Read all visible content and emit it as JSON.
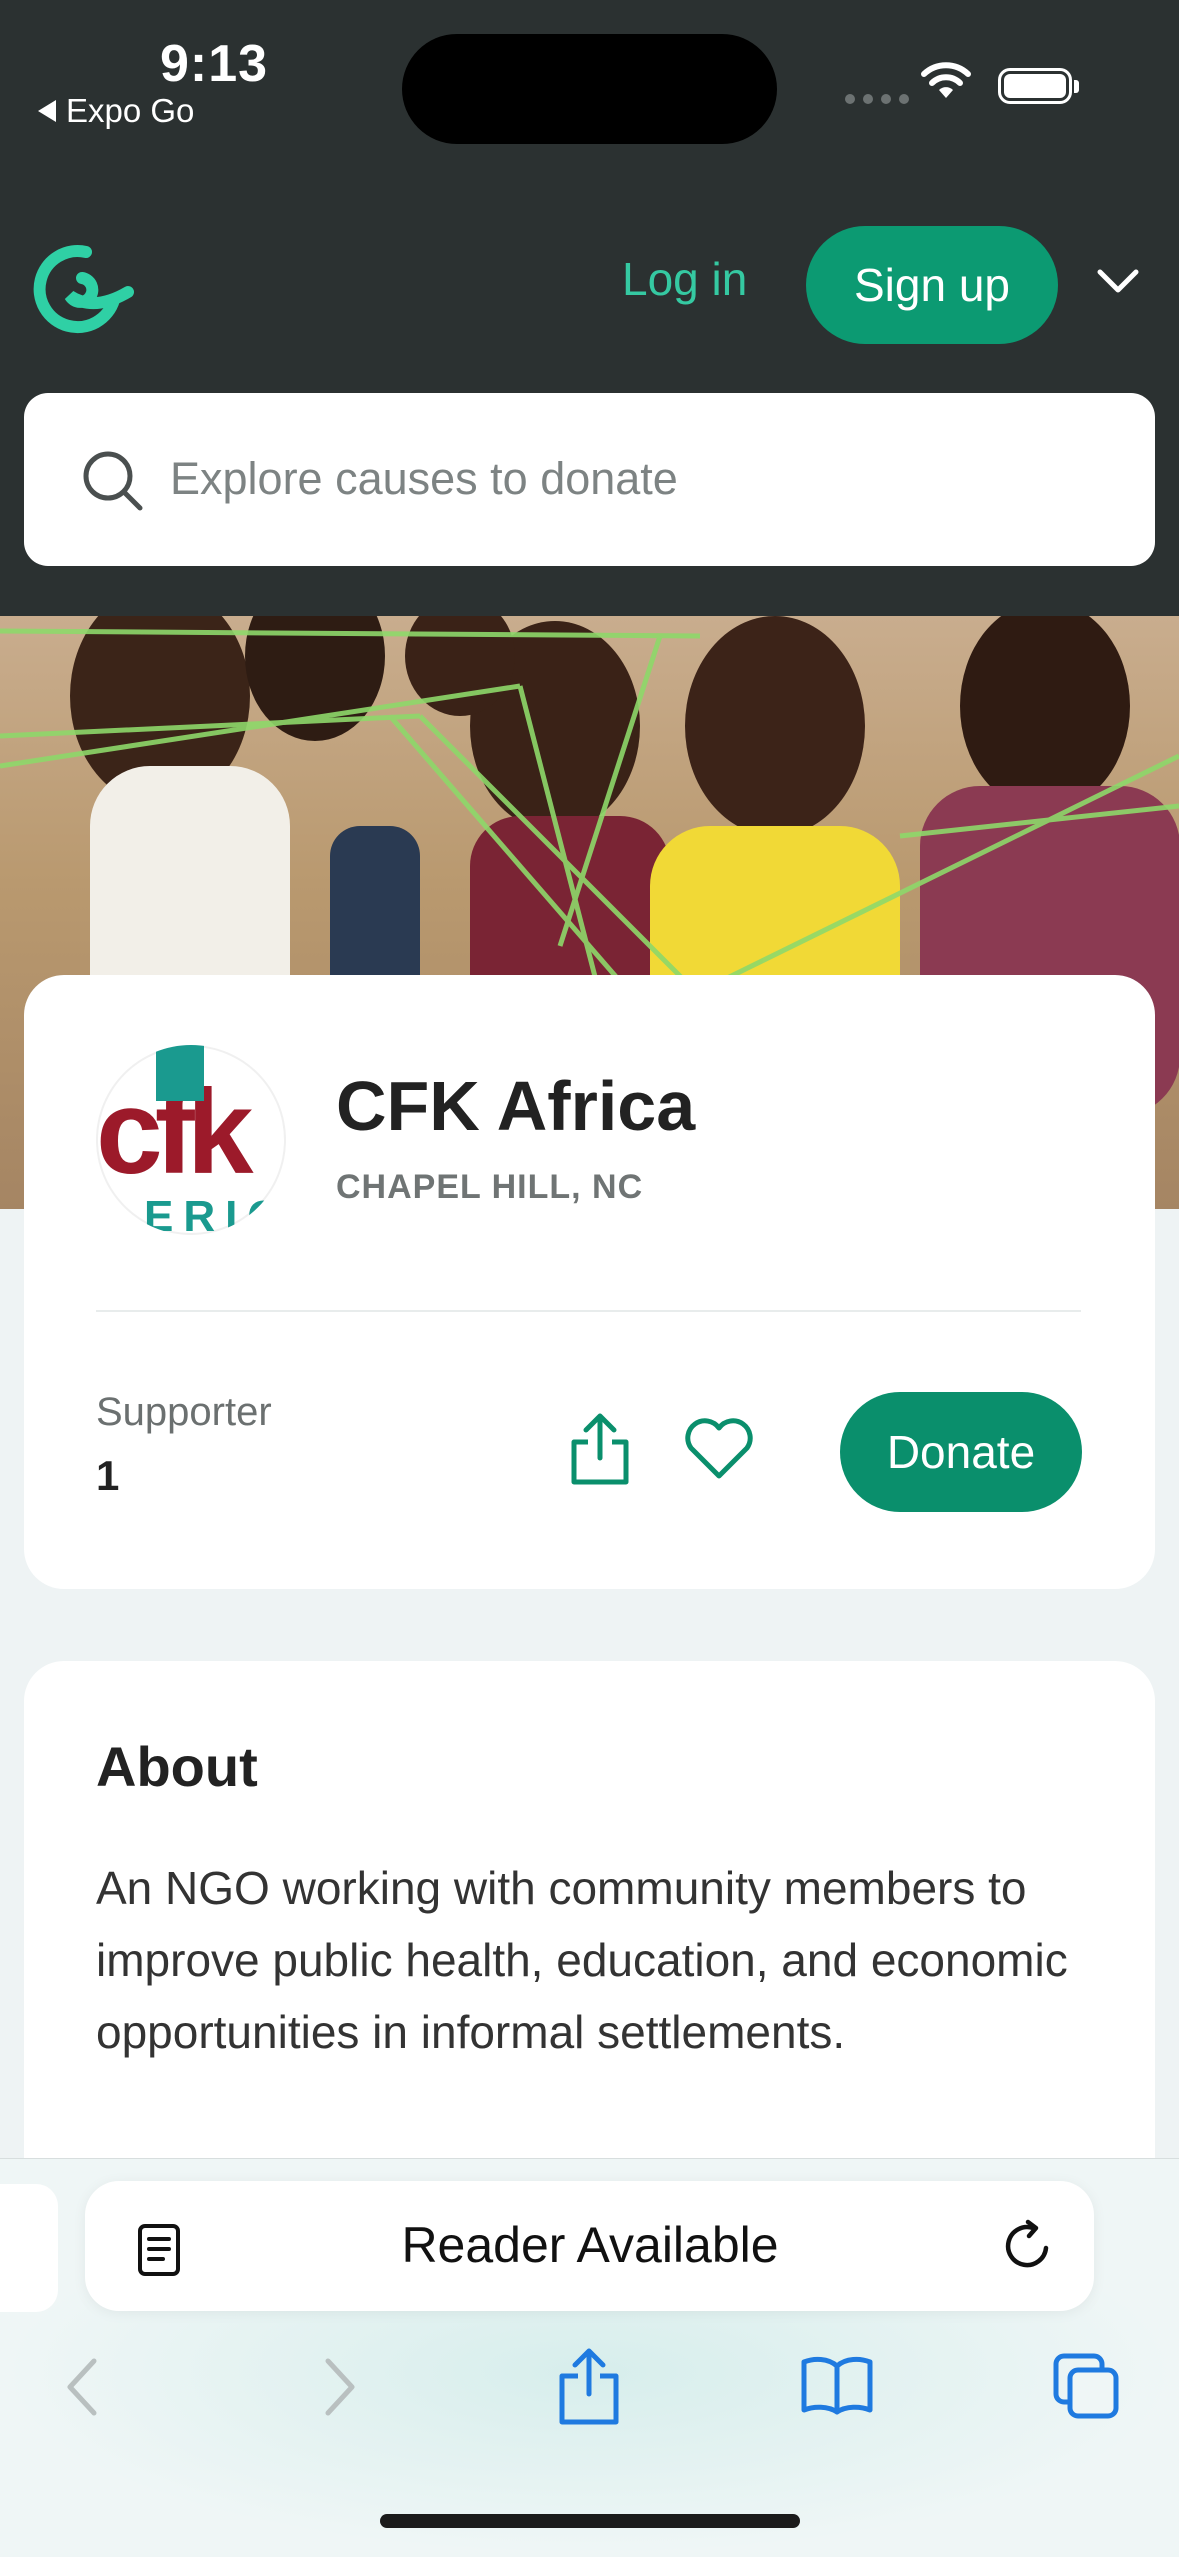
{
  "status_bar": {
    "time": "9:13",
    "back_app": "Expo Go"
  },
  "header": {
    "login_label": "Log in",
    "signup_label": "Sign up",
    "brand_color": "#35c9a2"
  },
  "search": {
    "placeholder": "Explore causes to donate"
  },
  "org": {
    "name": "CFK Africa",
    "location": "CHAPEL HILL, NC",
    "logo_text": "cfk",
    "logo_subtext": "ERIC",
    "supporter_label": "Supporter",
    "supporter_count": "1",
    "donate_label": "Donate",
    "accent_color": "#0a8f6c"
  },
  "about": {
    "title": "About",
    "text": "An NGO working with community members to improve public health, education, and economic opportunities in informal settlements."
  },
  "browser": {
    "reader_label": "Reader Available"
  }
}
